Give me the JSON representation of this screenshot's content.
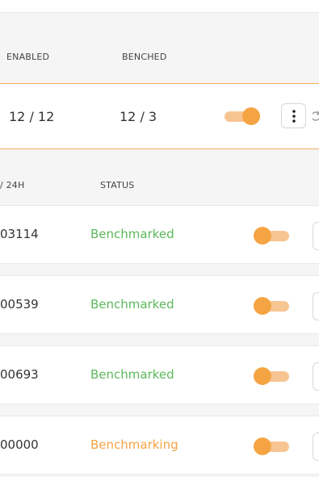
{
  "group_table": {
    "headers": {
      "enabled": "ENABLED",
      "benched": "BENCHED"
    },
    "row": {
      "enabled": "12 / 12",
      "benched": "12 / 3",
      "toggle_on": true
    }
  },
  "device_table": {
    "headers": {
      "rate_24h": "/ 24H",
      "status": "STATUS"
    },
    "rows": [
      {
        "value": "03114",
        "status": "Benchmarked",
        "status_color": "#5cb85c",
        "toggle_on": false
      },
      {
        "value": "00539",
        "status": "Benchmarked",
        "status_color": "#5cb85c",
        "toggle_on": false
      },
      {
        "value": "00693",
        "status": "Benchmarked",
        "status_color": "#5cb85c",
        "toggle_on": false
      },
      {
        "value": "00000",
        "status": "Benchmarking",
        "status_color": "#f5a444",
        "toggle_on": false
      }
    ]
  },
  "colors": {
    "accent": "#f5a444",
    "success": "#5cb85c",
    "border_highlight": "#f3ae5d"
  },
  "icons": {
    "menu": "kebab-vertical-icon",
    "refresh": "refresh-icon"
  }
}
